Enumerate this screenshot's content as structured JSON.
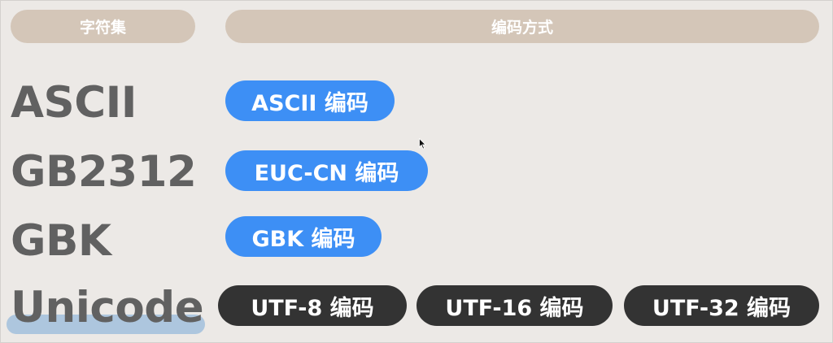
{
  "headers": {
    "charset": "字符集",
    "encoding": "编码方式"
  },
  "charsets": {
    "ascii": "ASCII",
    "gb2312": "GB2312",
    "gbk": "GBK",
    "unicode": "Unicode"
  },
  "encodings": {
    "ascii": "ASCII 编码",
    "euc_cn": "EUC-CN 编码",
    "gbk": "GBK 编码",
    "utf8": "UTF-8 编码",
    "utf16": "UTF-16 编码",
    "utf32": "UTF-32 编码"
  },
  "colors": {
    "header_bg": "#d4c6b8",
    "blue_pill": "#3d8ff5",
    "dark_pill": "#333333",
    "charset_text": "#616161",
    "unicode_highlight": "#a2bfdc",
    "background": "#ece9e6"
  },
  "icons": {
    "cursor": "mouse-pointer-icon"
  }
}
